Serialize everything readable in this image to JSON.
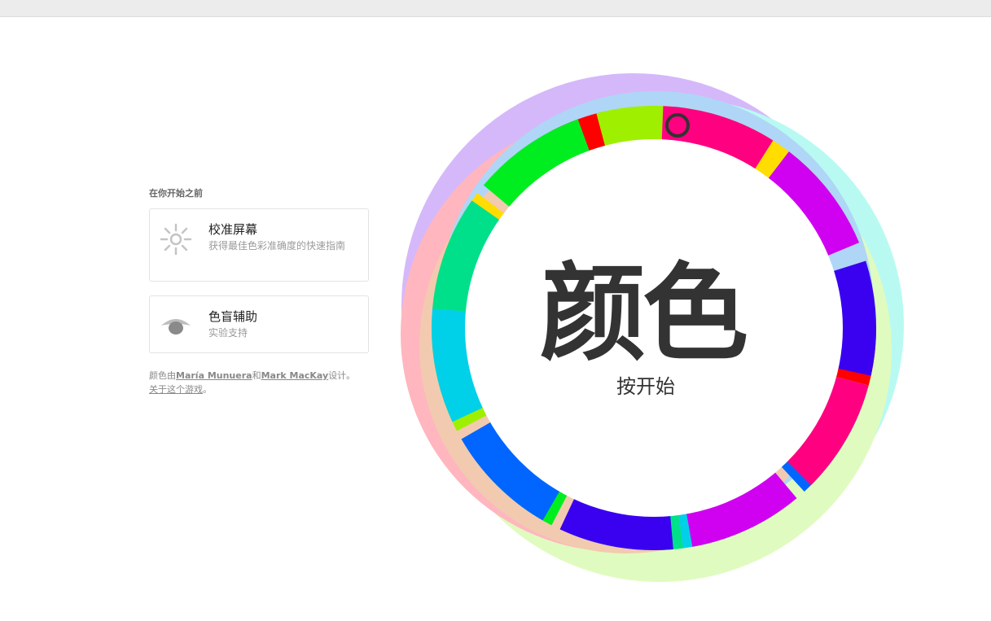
{
  "intro": {
    "heading": "在你开始之前",
    "cards": [
      {
        "title": "校准屏幕",
        "desc": "获得最佳色彩准确度的快速指南",
        "icon": "sun-brightness-icon"
      },
      {
        "title": "色盲辅助",
        "desc": "实验支持",
        "icon": "eye-icon"
      }
    ],
    "credits": {
      "prefix": "颜色由",
      "author1": "María Munuera",
      "and": "和",
      "author2": "Mark MacKay",
      "suffix": "设计。",
      "about_link": "关于这个游戏",
      "about_suffix": "。"
    }
  },
  "game": {
    "title": "颜色",
    "subtitle": "按开始"
  },
  "colors": {
    "overlay_purple": "#b37ff7",
    "overlay_blue": "#6fb5f0",
    "overlay_cyan": "#7ff7e8",
    "overlay_green": "#c8f88c",
    "overlay_red": "#ff7b8c",
    "overlay_orange": "#e8a070",
    "text": "#333333"
  }
}
